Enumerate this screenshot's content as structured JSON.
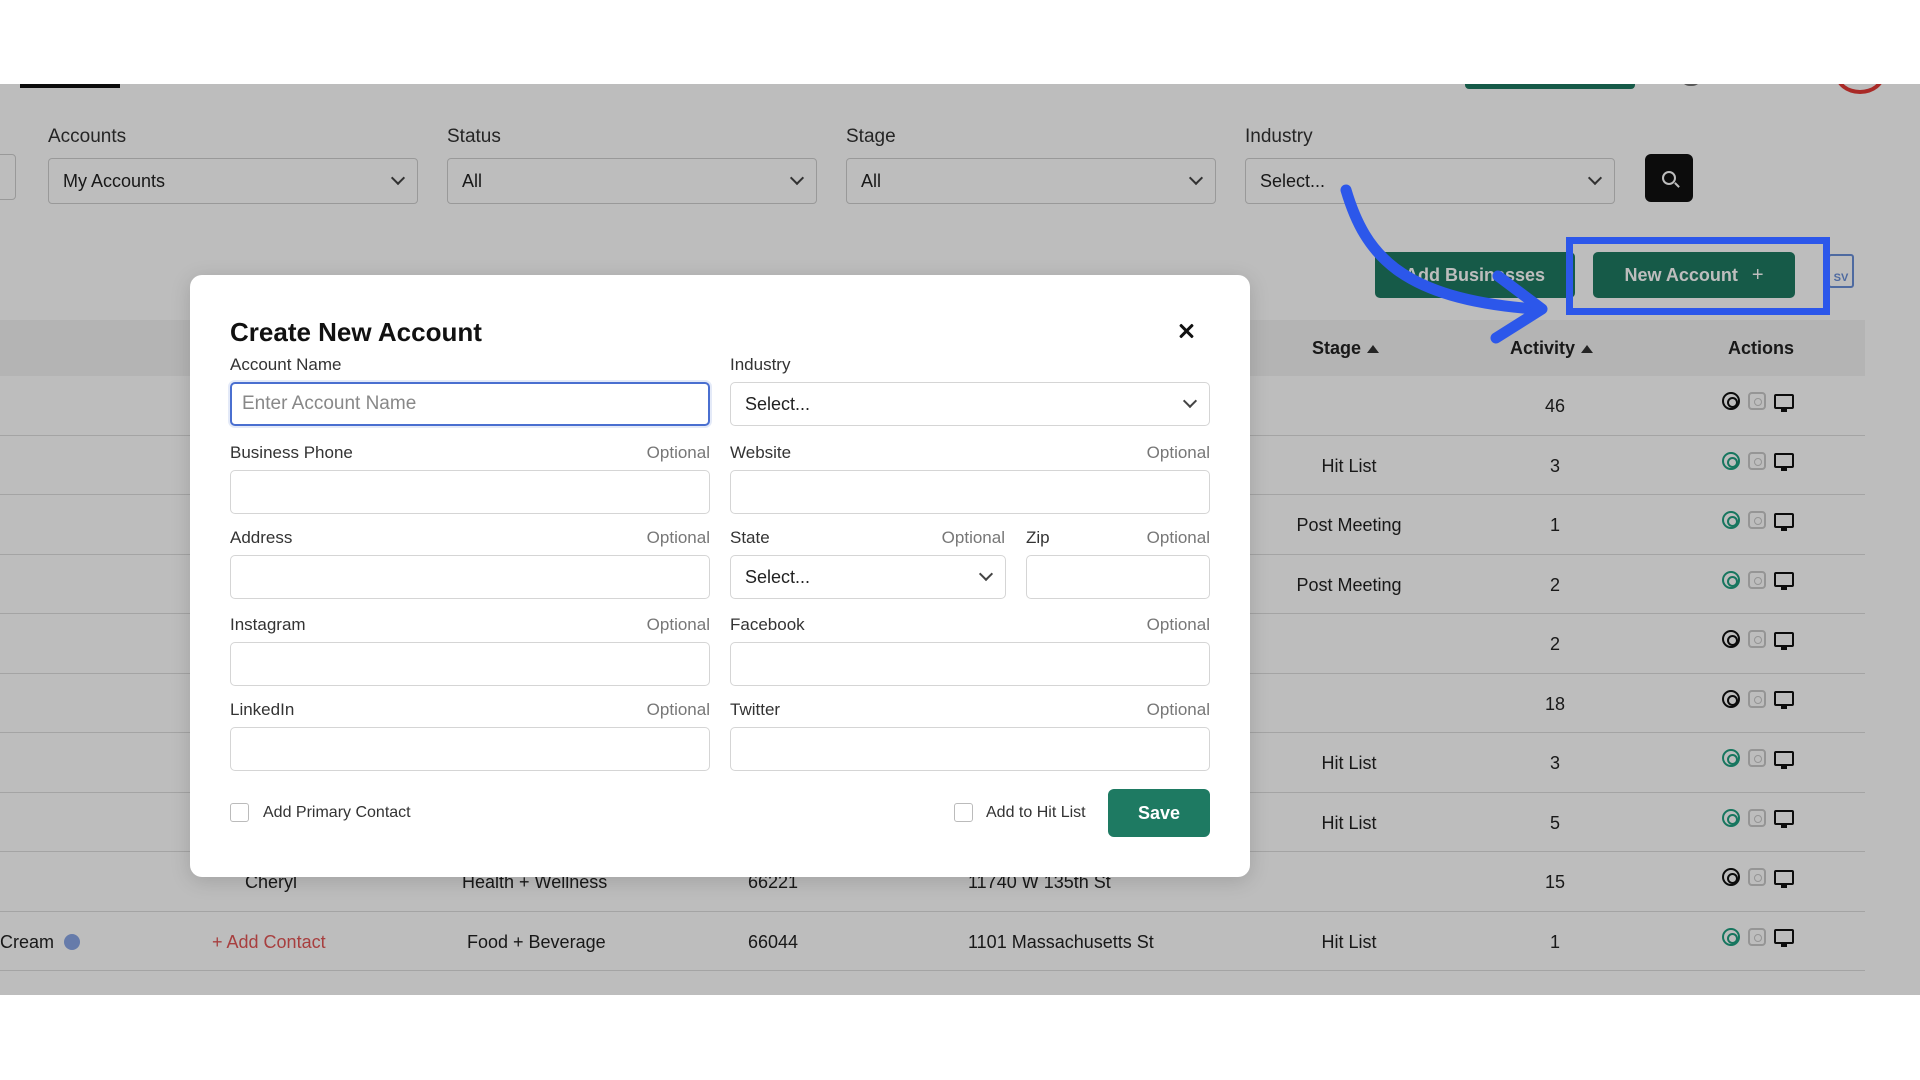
{
  "filters": [
    {
      "label": "Accounts",
      "value": "My Accounts"
    },
    {
      "label": "Status",
      "value": "All"
    },
    {
      "label": "Stage",
      "value": "All"
    },
    {
      "label": "Industry",
      "value": "Select..."
    }
  ],
  "toolbar": {
    "add_businesses_label": "Add Businesses",
    "new_account_label": "New Account",
    "new_account_icon": "+",
    "csv_label": "SV"
  },
  "table": {
    "headers": {
      "stage": "Stage",
      "activity": "Activity",
      "actions": "Actions"
    },
    "rows": [
      {
        "name": "",
        "contact": "",
        "industry": "",
        "zip": "",
        "address": "",
        "stage": "",
        "activity": "46",
        "target": "black"
      },
      {
        "name": "",
        "contact": "",
        "industry": "",
        "zip": "",
        "address": "",
        "stage": "Hit List",
        "activity": "3",
        "target": "green"
      },
      {
        "name": "",
        "contact": "",
        "industry": "",
        "zip": "",
        "address": "",
        "stage": "Post Meeting",
        "activity": "1",
        "target": "green"
      },
      {
        "name": "",
        "contact": "",
        "industry": "",
        "zip": "",
        "address": "",
        "stage": "Post Meeting",
        "activity": "2",
        "target": "green"
      },
      {
        "name": "",
        "contact": "",
        "industry": "",
        "zip": "",
        "address": "",
        "stage": "",
        "activity": "2",
        "target": "black"
      },
      {
        "name": "",
        "contact": "",
        "industry": "",
        "zip": "",
        "address": "",
        "stage": "",
        "activity": "18",
        "target": "black"
      },
      {
        "name": "",
        "contact": "",
        "industry": "",
        "zip": "",
        "address": "",
        "stage": "Hit List",
        "activity": "3",
        "target": "green"
      },
      {
        "name": "",
        "contact": "",
        "industry": "",
        "zip": "",
        "address": "",
        "stage": "Hit List",
        "activity": "5",
        "target": "green"
      },
      {
        "name": "",
        "contact": "Cheryl",
        "industry": "Health + Wellness",
        "zip": "66221",
        "address": "11740 W 135th St",
        "stage": "",
        "activity": "15",
        "target": "black"
      },
      {
        "name": "Cream",
        "contact": "+ Add Contact",
        "industry": "Food + Beverage",
        "zip": "66044",
        "address": "1101 Massachusetts St",
        "stage": "Hit List",
        "activity": "1",
        "target": "green"
      }
    ]
  },
  "modal": {
    "title": "Create New Account",
    "optional_text": "Optional",
    "fields": {
      "account_name": {
        "label": "Account Name",
        "placeholder": "Enter Account Name",
        "value": ""
      },
      "industry": {
        "label": "Industry",
        "value": "Select..."
      },
      "business_phone": {
        "label": "Business Phone",
        "value": ""
      },
      "website": {
        "label": "Website",
        "value": ""
      },
      "address": {
        "label": "Address",
        "value": ""
      },
      "state": {
        "label": "State",
        "value": "Select..."
      },
      "zip": {
        "label": "Zip",
        "value": ""
      },
      "instagram": {
        "label": "Instagram",
        "value": ""
      },
      "facebook": {
        "label": "Facebook",
        "value": ""
      },
      "linkedin": {
        "label": "LinkedIn",
        "value": ""
      },
      "twitter": {
        "label": "Twitter",
        "value": ""
      }
    },
    "add_primary_contact_label": "Add Primary Contact",
    "add_to_hit_list_label": "Add to Hit List",
    "save_label": "Save"
  },
  "colors": {
    "accent": "#1e7a62",
    "highlight": "#2c57ea",
    "link_red": "#e25555"
  }
}
